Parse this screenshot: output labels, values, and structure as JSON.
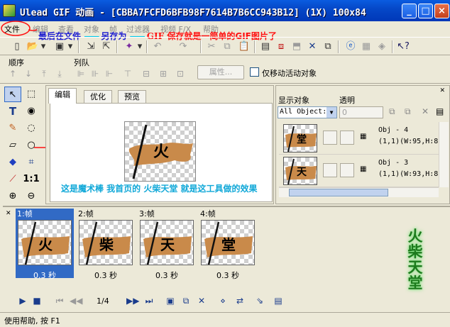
{
  "window": {
    "title": "Ulead GIF 动画 - [CBBA7FCFD6BFB98F7614B7B6CC943B12] (1X) 100x84",
    "minimize": "_",
    "maximize": "□",
    "close": "×"
  },
  "menu": [
    "文件",
    "编辑",
    "查看",
    "对象",
    "帧",
    "过滤器",
    "视频 F/X",
    "帮助"
  ],
  "annotations": {
    "top_part1": "最后在文件",
    "top_part2": "另存为",
    "top_part3": "GIF",
    "top_part4": "保存就是一简单的GIF图片了",
    "middle": "这是魔术棒 我首页的 火柴天堂 就是这工具做的效果"
  },
  "order_group": {
    "label": "顺序"
  },
  "align_group": {
    "label": "列队"
  },
  "properties_button": "属性...",
  "move_active_only": {
    "label": "仅移动活动对象",
    "checked": false
  },
  "editor_tabs": [
    "编辑",
    "优化",
    "预览"
  ],
  "editor_active_tab": "编辑",
  "canvas_glyph": "火",
  "object_panel": {
    "display_label": "显示对象",
    "display_value": "All Object:",
    "opacity_label": "透明",
    "opacity_value": "0",
    "objects": [
      {
        "glyph": "堂",
        "name": "Obj - 4",
        "info": "(1,1)(W:95,H:8"
      },
      {
        "glyph": "天",
        "name": "Obj - 3",
        "info": "(1,1)(W:93,H:8"
      }
    ]
  },
  "frames": [
    {
      "label": "1:帧",
      "glyph": "火",
      "delay": "0.3 秒",
      "selected": true
    },
    {
      "label": "2:帧",
      "glyph": "柴",
      "delay": "0.3 秒",
      "selected": false
    },
    {
      "label": "3:帧",
      "glyph": "天",
      "delay": "0.3 秒",
      "selected": false
    },
    {
      "label": "4:帧",
      "glyph": "堂",
      "delay": "0.3 秒",
      "selected": false
    }
  ],
  "playback": {
    "counter": "1/4"
  },
  "logo_text": [
    "火",
    "柴",
    "天",
    "堂"
  ],
  "status": "使用帮助, 按 F1",
  "colors": {
    "title_bar": "#0548c8",
    "selection": "#316ac5",
    "annotation_blue": "#1a1ad0",
    "annotation_red": "#ff1010",
    "flag_brown": "#c98a4a",
    "logo_green": "#1d7a1d"
  }
}
